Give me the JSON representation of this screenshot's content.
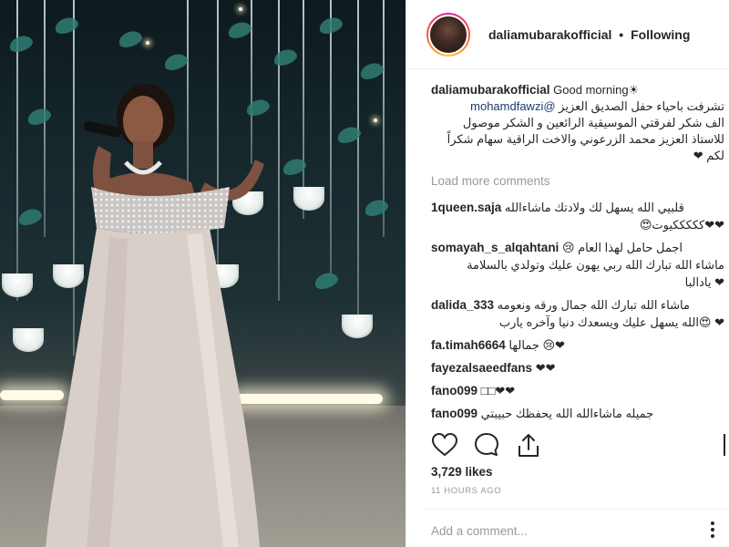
{
  "post": {
    "username": "daliamubarakofficial",
    "follow_status": "Following",
    "separator": "•",
    "caption": {
      "username": "daliamubarakofficial",
      "text": "Good morning☀",
      "mention": "@mohamdfawzi",
      "lines": [
        "تشرفت باحياء حفل الصديق العزيز",
        "الف شكر لفرقتي الموسيقية الرائعين و الشكر موصول",
        "للاستاذ العزيز محمد الزرعوني والاخت الراقية سهام شكراً",
        "لكم ❤"
      ]
    },
    "load_more": "Load more comments",
    "comments": [
      {
        "username": "1queen.saja",
        "text": "قلبيي الله يسهل لك ولادتك ماشاءالله",
        "extra": "❤❤كككككيوت😍"
      },
      {
        "username": "somayah_s_alqahtani",
        "text": "😢 اجمل حامل لهذا العام",
        "extra": "ماشاء الله تبارك الله ربي يهون عليك وتولدي بالسلامة",
        "extra2": "❤ يادالبا"
      },
      {
        "username": "dalida_333",
        "text": "ماشاء الله تبارك الله جمال ورقه ونعومه",
        "extra": "❤ 😍الله يسهل عليك ويسعدك دنيا وآخره يارب"
      },
      {
        "username": "fa.timah6664",
        "text": "جمالها 😢❤"
      },
      {
        "username": "fayezalsaeedfans",
        "text": "❤❤"
      },
      {
        "username": "fano099",
        "text": "□□❤❤"
      },
      {
        "username": "fano099",
        "text": "جميله ماشاءالله الله يحفظك حبيبتي"
      }
    ],
    "likes": "3,729 likes",
    "time": "11 HOURS AGO",
    "add_comment_placeholder": "Add a comment...",
    "icons": {
      "like": "heart-icon",
      "comment": "comment-icon",
      "share": "share-icon",
      "more": "options-icon"
    }
  }
}
